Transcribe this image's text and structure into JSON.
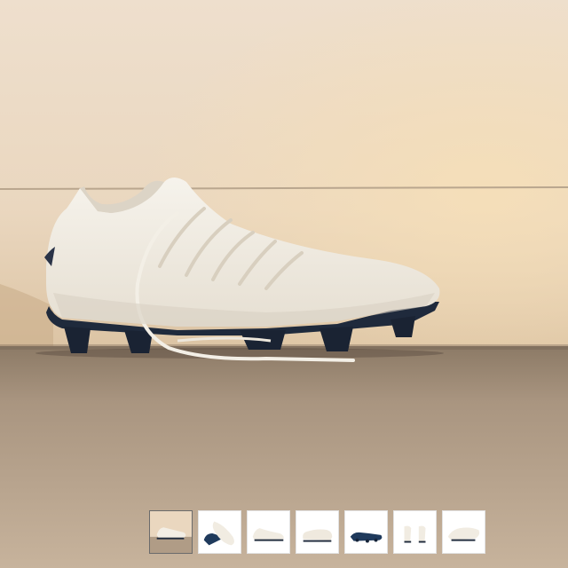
{
  "gallery": {
    "main_image": {
      "icon": "football-boot-photo",
      "wall_color": "#ead8c2",
      "ground_color": "#b5a28d",
      "boot_color": "#f2ede4",
      "soleplate_color": "#1f2a3c"
    },
    "thumbnails": [
      {
        "icon": "boot-lifestyle-thumbnail",
        "selected": true
      },
      {
        "icon": "boot-top-view-thumbnail",
        "selected": false
      },
      {
        "icon": "boot-side-view-thumbnail",
        "selected": false
      },
      {
        "icon": "boot-medial-view-thumbnail",
        "selected": false
      },
      {
        "icon": "boot-soleplate-thumbnail",
        "selected": false
      },
      {
        "icon": "boot-heel-pair-thumbnail",
        "selected": false
      },
      {
        "icon": "boot-angle-view-thumbnail",
        "selected": false
      }
    ],
    "selected_index": 0
  }
}
